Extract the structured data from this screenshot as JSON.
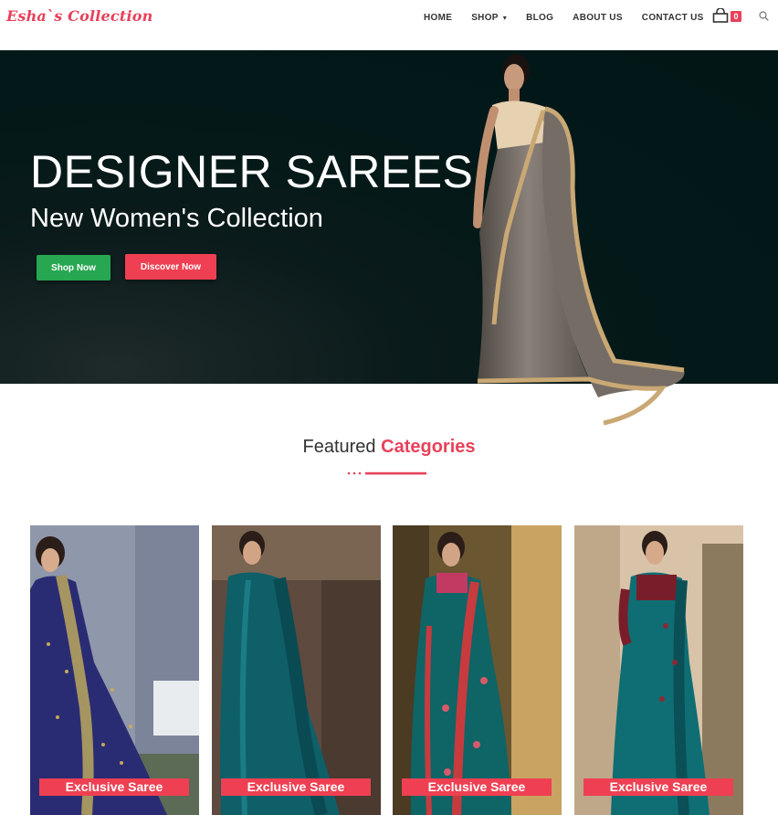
{
  "header": {
    "logo": "Esha`s Collection",
    "nav": [
      {
        "label": "HOME"
      },
      {
        "label": "SHOP"
      },
      {
        "label": "BLOG"
      },
      {
        "label": "ABOUT US"
      },
      {
        "label": "CONTACT US"
      }
    ],
    "cart_count": "0"
  },
  "hero": {
    "title": "DESIGNER SAREES",
    "subtitle": "New Women's Collection",
    "shop_now": "Shop Now",
    "discover_now": "Discover Now"
  },
  "featured": {
    "prefix": "Featured",
    "accent": "Categories"
  },
  "categories": [
    {
      "label": "Exclusive Saree"
    },
    {
      "label": "Exclusive Saree"
    },
    {
      "label": "Exclusive Saree"
    },
    {
      "label": "Exclusive Saree"
    }
  ],
  "colors": {
    "brand": "#e8415a",
    "green": "#27a751",
    "hero_bg": "#031818"
  }
}
